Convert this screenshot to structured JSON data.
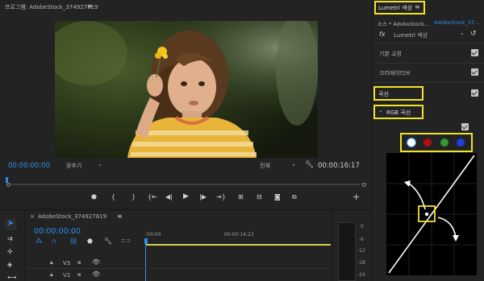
{
  "program": {
    "title": "프로그램: AdobeStock_374927819",
    "timecode_in": "00:00:00:00",
    "fit_label": "맞추기",
    "quality_label": "전체",
    "timecode_out": "00:00:16:17"
  },
  "lumetri": {
    "panel_tab": "Lumetri 색상",
    "source_label": "소스 * AdobeStock...",
    "clip_label": "AdobeStock_37...",
    "effect_name": "Lumetri 색상",
    "sections": [
      {
        "label": "기본 교정"
      },
      {
        "label": "크리에이티브"
      },
      {
        "label": "곡선"
      }
    ],
    "rgb_curves_label": "RGB 곡선",
    "channel_colors": [
      "#ffffff",
      "#b20f0f",
      "#2f9a2f",
      "#1c3fd8"
    ]
  },
  "timeline": {
    "title": "AdobeStock_374927819",
    "timecode": "00:00:00:00",
    "ruler_start": ":00:00",
    "ruler_mid": "00:00:14:23",
    "tracks": [
      {
        "label": "V3"
      },
      {
        "label": "V2"
      }
    ]
  },
  "meter": {
    "scale": [
      "0",
      "-6",
      "-12",
      "-18",
      "-24"
    ]
  },
  "colors": {
    "accent_blue": "#2d8ceb",
    "highlight_yellow": "#f2e22a",
    "work_area_yellow": "#d8d24a"
  }
}
